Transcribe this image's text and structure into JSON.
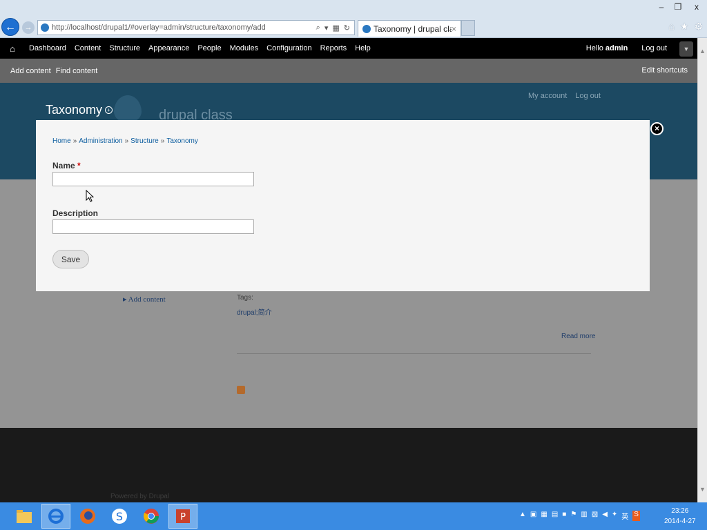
{
  "browser": {
    "url": "http://localhost/drupal1/#overlay=admin/structure/taxonomy/add",
    "tab_title": "Taxonomy | drupal class",
    "tab_close": "×",
    "back_icon": "←",
    "forward_icon": "→",
    "window_controls": {
      "minimize": "–",
      "restore": "❐",
      "close": "x"
    },
    "tools": {
      "home": "⌂",
      "favorites": "★",
      "settings": "⚙"
    }
  },
  "toolbar": {
    "home_icon": "⌂",
    "menu": [
      "Dashboard",
      "Content",
      "Structure",
      "Appearance",
      "People",
      "Modules",
      "Configuration",
      "Reports",
      "Help"
    ],
    "hello": "Hello",
    "username": "admin",
    "logout": "Log out",
    "drawer_toggle": "▼"
  },
  "shortcuts": {
    "items": [
      "Add content",
      "Find content"
    ],
    "edit": "Edit shortcuts"
  },
  "site": {
    "page_title": "Taxonomy",
    "site_name": "drupal class",
    "links": [
      "My account",
      "Log out"
    ],
    "sidebar_link": "Add content",
    "tags_label": "Tags:",
    "tags_value": "drupal;简介",
    "read_more": "Read more",
    "powered_by": "Powered by Drupal"
  },
  "overlay": {
    "close": "×",
    "breadcrumb": [
      "Home",
      "Administration",
      "Structure",
      "Taxonomy"
    ],
    "breadcrumb_sep": "»",
    "fields": {
      "name": {
        "label": "Name",
        "required_mark": "*",
        "value": ""
      },
      "description": {
        "label": "Description",
        "value": ""
      }
    },
    "save_label": "Save"
  },
  "taskbar": {
    "clock_time": "23:26",
    "clock_date": "2014-4-27"
  },
  "colors": {
    "toolbar_bg": "#000000",
    "shortcut_bg": "#666666",
    "header_bg": "#1c4962",
    "link": "#0b5c9e",
    "taskbar": "#3a8be2"
  }
}
